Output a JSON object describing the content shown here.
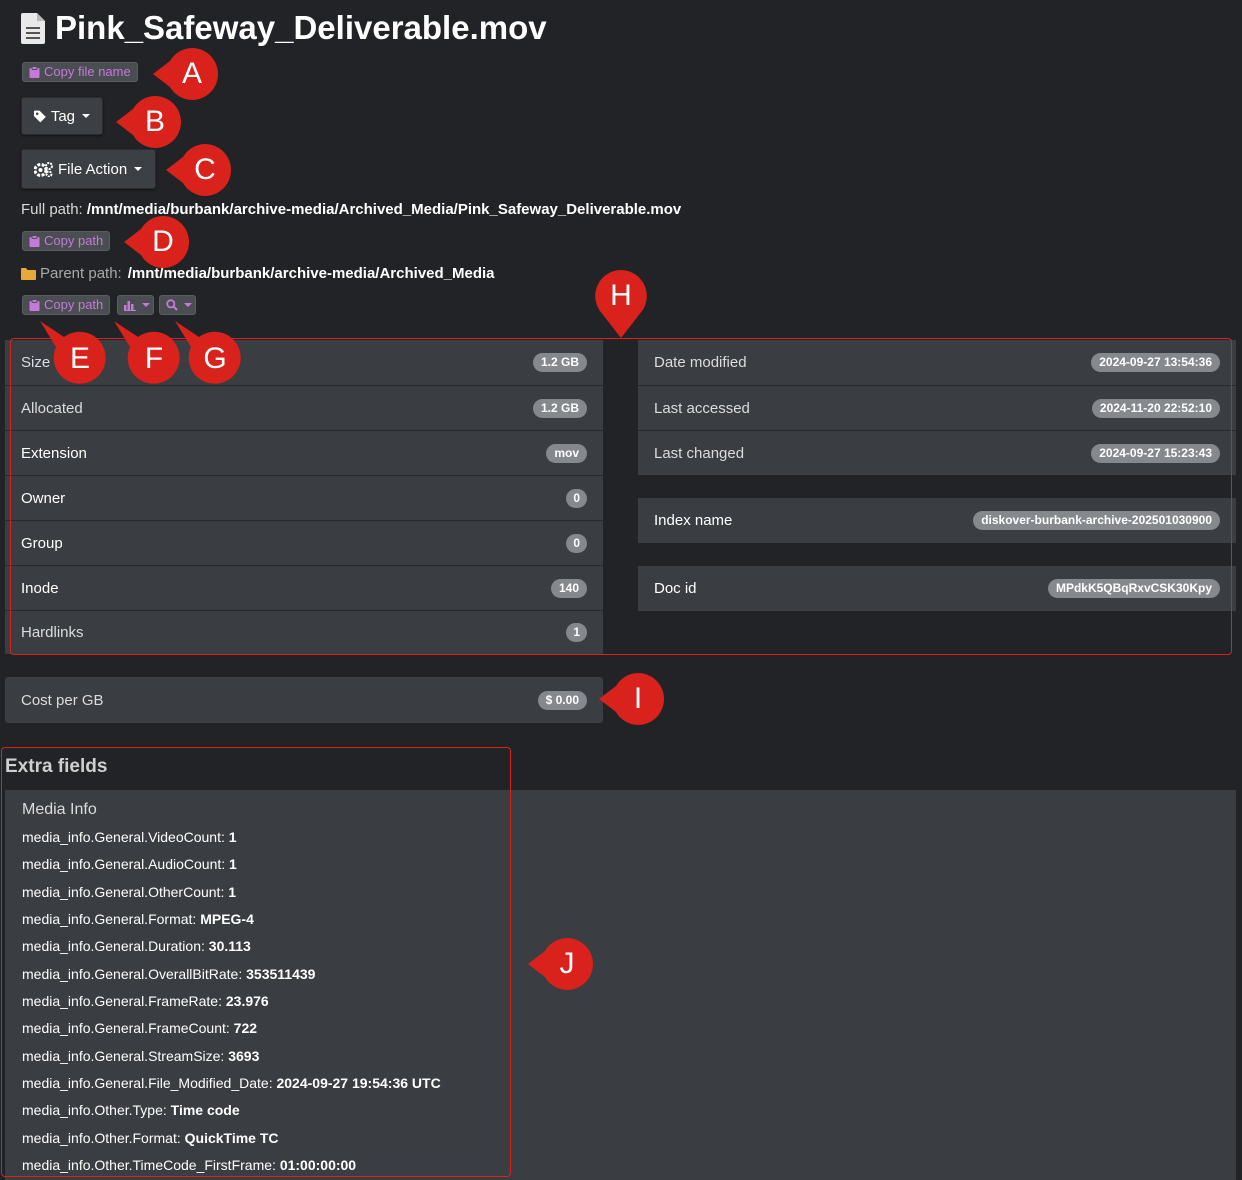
{
  "file": {
    "name": "Pink_Safeway_Deliverable.mov",
    "copy_file_name_label": "Copy file name",
    "tag_label": "Tag",
    "file_action_label": "File Action",
    "full_path_label": "Full path:",
    "full_path": "/mnt/media/burbank/archive-media/Archived_Media/Pink_Safeway_Deliverable.mov",
    "copy_path_label": "Copy path",
    "parent_path_label": "Parent path:",
    "parent_path": "/mnt/media/burbank/archive-media/Archived_Media",
    "copy_parent_path_label": "Copy path"
  },
  "info_left": [
    {
      "label": "Size",
      "value": "1.2 GB"
    },
    {
      "label": "Allocated",
      "value": "1.2 GB"
    },
    {
      "label": "Extension",
      "value": "mov"
    },
    {
      "label": "Owner",
      "value": "0"
    },
    {
      "label": "Group",
      "value": "0"
    },
    {
      "label": "Inode",
      "value": "140"
    },
    {
      "label": "Hardlinks",
      "value": "1"
    }
  ],
  "info_right_dates": [
    {
      "label": "Date modified",
      "value": "2024-09-27 13:54:36"
    },
    {
      "label": "Last accessed",
      "value": "2024-11-20 22:52:10"
    },
    {
      "label": "Last changed",
      "value": "2024-09-27 15:23:43"
    }
  ],
  "index": {
    "label": "Index name",
    "value": "diskover-burbank-archive-202501030900"
  },
  "doc": {
    "label": "Doc id",
    "value": "MPdkK5QBqRxvCSK30Kpy"
  },
  "cost": {
    "label": "Cost per GB",
    "value": "$ 0.00"
  },
  "extra": {
    "title": "Extra fields",
    "section": "Media Info",
    "fields": [
      {
        "key": "media_info.General.VideoCount:",
        "value": "1"
      },
      {
        "key": "media_info.General.AudioCount:",
        "value": "1"
      },
      {
        "key": "media_info.General.OtherCount:",
        "value": "1"
      },
      {
        "key": "media_info.General.Format:",
        "value": "MPEG-4"
      },
      {
        "key": "media_info.General.Duration:",
        "value": "30.113"
      },
      {
        "key": "media_info.General.OverallBitRate:",
        "value": "353511439"
      },
      {
        "key": "media_info.General.FrameRate:",
        "value": "23.976"
      },
      {
        "key": "media_info.General.FrameCount:",
        "value": "722"
      },
      {
        "key": "media_info.General.StreamSize:",
        "value": "3693"
      },
      {
        "key": "media_info.General.File_Modified_Date:",
        "value": "2024-09-27 19:54:36 UTC"
      },
      {
        "key": "media_info.Other.Type:",
        "value": "Time code"
      },
      {
        "key": "media_info.Other.Format:",
        "value": "QuickTime TC"
      },
      {
        "key": "media_info.Other.TimeCode_FirstFrame:",
        "value": "01:00:00:00"
      }
    ]
  },
  "markers": [
    "A",
    "B",
    "C",
    "D",
    "E",
    "F",
    "G",
    "H",
    "I",
    "J"
  ],
  "icons": {
    "file": "file-text-icon",
    "clipboard": "clipboard-icon",
    "tag": "tag-icon",
    "gears": "gears-icon",
    "folder": "folder-icon",
    "chart": "bar-chart-icon",
    "search": "search-icon"
  },
  "colors": {
    "background": "#222326",
    "panel": "#3a3d42",
    "accent_purple": "#c47ad9",
    "badge": "#85888d",
    "annotation_red": "#d9221c",
    "folder_orange": "#e8a93c"
  }
}
